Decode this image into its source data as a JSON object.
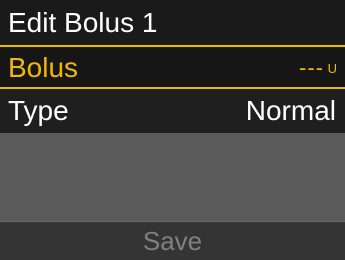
{
  "header": {
    "title": "Edit Bolus 1"
  },
  "rows": {
    "bolus": {
      "label": "Bolus",
      "value": "---",
      "unit": "U"
    },
    "type": {
      "label": "Type",
      "value": "Normal"
    }
  },
  "footer": {
    "save_label": "Save"
  },
  "colors": {
    "accent": "#f2b705",
    "title_bg": "#1a1a1a",
    "row_bg": "#1f1f1f",
    "empty_bg": "#5a5a5a",
    "footer_bg": "#343434",
    "disabled_text": "#808080"
  }
}
